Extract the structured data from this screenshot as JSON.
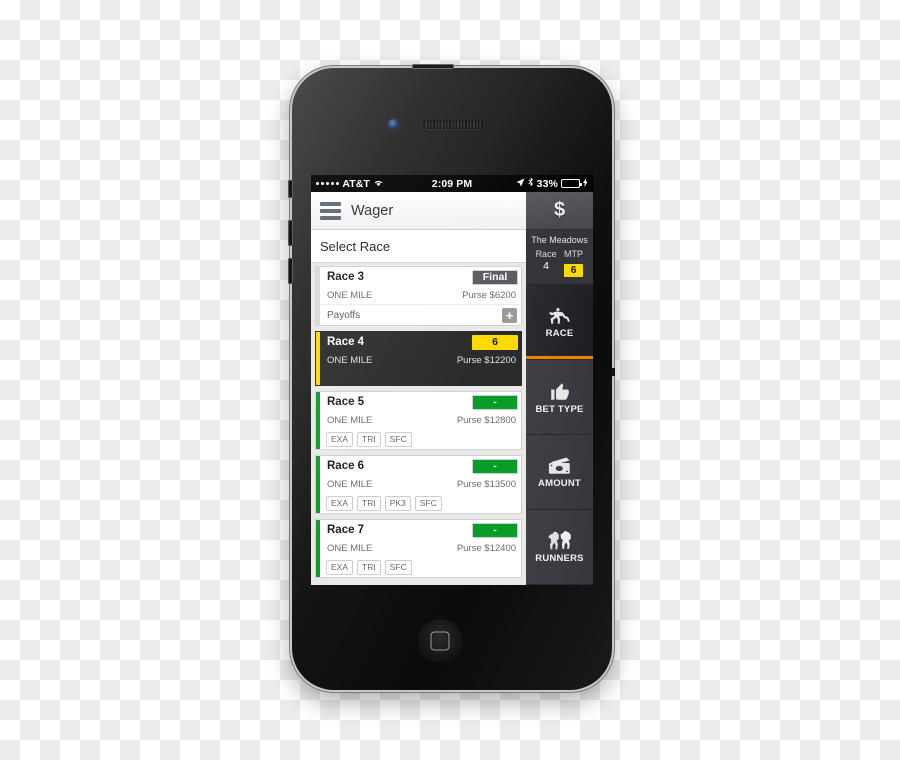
{
  "status_bar": {
    "carrier": "AT&T",
    "signal_dots": 5,
    "wifi_icon": "wifi-icon",
    "time": "2:09 PM",
    "location_icon": "location-arrow-icon",
    "bluetooth_icon": "bluetooth-icon",
    "battery_percent": "33%",
    "battery_level": 33,
    "charging_icon": "lightning-bolt-icon"
  },
  "header": {
    "menu_icon": "hamburger-menu-icon",
    "title": "Wager",
    "dollar_label": "$"
  },
  "main": {
    "section_title": "Select Race",
    "races": [
      {
        "name": "Race 3",
        "badge": "Final",
        "badge_type": "final",
        "distance": "ONE MILE",
        "purse": "Purse $6200",
        "accent": "#d8d8d8",
        "selected": false,
        "payoffs_label": "Payoffs",
        "plus_label": "+",
        "tags": []
      },
      {
        "name": "Race 4",
        "badge": "6",
        "badge_type": "yellow",
        "distance": "ONE MILE",
        "purse": "Purse $12200",
        "accent": "#ffd900",
        "selected": true,
        "tags": []
      },
      {
        "name": "Race 5",
        "badge": "-",
        "badge_type": "green",
        "distance": "ONE MILE",
        "purse": "Purse $12800",
        "accent": "#0b9b28",
        "selected": false,
        "tags": [
          "EXA",
          "TRI",
          "SFC"
        ]
      },
      {
        "name": "Race 6",
        "badge": "-",
        "badge_type": "green",
        "distance": "ONE MILE",
        "purse": "Purse $13500",
        "accent": "#0b9b28",
        "selected": false,
        "tags": [
          "EXA",
          "TRI",
          "PK3",
          "SFC"
        ]
      },
      {
        "name": "Race 7",
        "badge": "-",
        "badge_type": "green",
        "distance": "ONE MILE",
        "purse": "Purse $12400",
        "accent": "#0b9b28",
        "selected": false,
        "tags": [
          "EXA",
          "TRI",
          "SFC"
        ]
      }
    ]
  },
  "sidebar": {
    "track": "The Meadows",
    "race_label": "Race",
    "race_value": "4",
    "mtp_label": "MTP",
    "mtp_value": "6",
    "tabs": [
      {
        "label": "RACE",
        "icon": "horse-jockey-icon",
        "active": true
      },
      {
        "label": "BET TYPE",
        "icon": "thumbs-up-icon",
        "active": false
      },
      {
        "label": "AMOUNT",
        "icon": "money-cash-icon",
        "active": false
      },
      {
        "label": "RUNNERS",
        "icon": "two-horses-icon",
        "active": false
      }
    ]
  },
  "colors": {
    "accent_orange": "#f08000",
    "highlight_yellow": "#ffd900",
    "status_green": "#0b9b28",
    "selected_dark": "#2b2b2b"
  }
}
